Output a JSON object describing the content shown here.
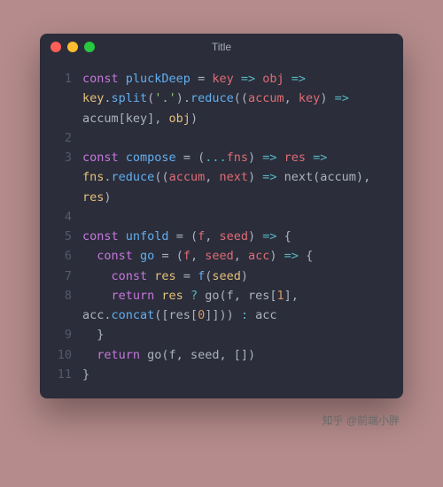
{
  "window": {
    "title": "Title",
    "dots": {
      "red": "#ff5f57",
      "yellow": "#febc2e",
      "green": "#28c840"
    }
  },
  "code": {
    "lines": [
      {
        "num": "1",
        "tokens": [
          {
            "t": "const ",
            "c": "kw"
          },
          {
            "t": "pluckDeep",
            "c": "fn"
          },
          {
            "t": " = ",
            "c": "pn"
          },
          {
            "t": "key",
            "c": "pr"
          },
          {
            "t": " => ",
            "c": "op"
          },
          {
            "t": "obj",
            "c": "pr"
          },
          {
            "t": " => ",
            "c": "op"
          },
          {
            "t": "key",
            "c": "id"
          },
          {
            "t": ".",
            "c": "pn"
          },
          {
            "t": "split",
            "c": "fn"
          },
          {
            "t": "(",
            "c": "pn"
          },
          {
            "t": "'.'",
            "c": "str"
          },
          {
            "t": ").",
            "c": "pn"
          },
          {
            "t": "reduce",
            "c": "fn"
          },
          {
            "t": "((",
            "c": "pn"
          },
          {
            "t": "accum",
            "c": "pr"
          },
          {
            "t": ", ",
            "c": "pn"
          },
          {
            "t": "key",
            "c": "pr"
          },
          {
            "t": ") ",
            "c": "pn"
          },
          {
            "t": "=>",
            "c": "op"
          },
          {
            "t": " accum[key], ",
            "c": "pn"
          },
          {
            "t": "obj",
            "c": "id"
          },
          {
            "t": ")",
            "c": "pn"
          }
        ]
      },
      {
        "num": "2",
        "tokens": []
      },
      {
        "num": "3",
        "tokens": [
          {
            "t": "const ",
            "c": "kw"
          },
          {
            "t": "compose",
            "c": "fn"
          },
          {
            "t": " = (",
            "c": "pn"
          },
          {
            "t": "...",
            "c": "op"
          },
          {
            "t": "fns",
            "c": "pr"
          },
          {
            "t": ") ",
            "c": "pn"
          },
          {
            "t": "=>",
            "c": "op"
          },
          {
            "t": " ",
            "c": "pn"
          },
          {
            "t": "res",
            "c": "pr"
          },
          {
            "t": " => ",
            "c": "op"
          },
          {
            "t": "fns",
            "c": "id"
          },
          {
            "t": ".",
            "c": "pn"
          },
          {
            "t": "reduce",
            "c": "fn"
          },
          {
            "t": "((",
            "c": "pn"
          },
          {
            "t": "accum",
            "c": "pr"
          },
          {
            "t": ", ",
            "c": "pn"
          },
          {
            "t": "next",
            "c": "pr"
          },
          {
            "t": ") ",
            "c": "pn"
          },
          {
            "t": "=>",
            "c": "op"
          },
          {
            "t": " next(accum), ",
            "c": "pn"
          },
          {
            "t": "res",
            "c": "id"
          },
          {
            "t": ")",
            "c": "pn"
          }
        ]
      },
      {
        "num": "4",
        "tokens": []
      },
      {
        "num": "5",
        "tokens": [
          {
            "t": "const ",
            "c": "kw"
          },
          {
            "t": "unfold",
            "c": "fn"
          },
          {
            "t": " = (",
            "c": "pn"
          },
          {
            "t": "f",
            "c": "pr"
          },
          {
            "t": ", ",
            "c": "pn"
          },
          {
            "t": "seed",
            "c": "pr"
          },
          {
            "t": ") ",
            "c": "pn"
          },
          {
            "t": "=>",
            "c": "op"
          },
          {
            "t": " {",
            "c": "pn"
          }
        ]
      },
      {
        "num": "6",
        "tokens": [
          {
            "t": "  ",
            "c": "pn"
          },
          {
            "t": "const ",
            "c": "kw"
          },
          {
            "t": "go",
            "c": "fn"
          },
          {
            "t": " = (",
            "c": "pn"
          },
          {
            "t": "f",
            "c": "pr"
          },
          {
            "t": ", ",
            "c": "pn"
          },
          {
            "t": "seed",
            "c": "pr"
          },
          {
            "t": ", ",
            "c": "pn"
          },
          {
            "t": "acc",
            "c": "pr"
          },
          {
            "t": ") ",
            "c": "pn"
          },
          {
            "t": "=>",
            "c": "op"
          },
          {
            "t": " {",
            "c": "pn"
          }
        ]
      },
      {
        "num": "7",
        "tokens": [
          {
            "t": "    ",
            "c": "pn"
          },
          {
            "t": "const ",
            "c": "kw"
          },
          {
            "t": "res",
            "c": "id"
          },
          {
            "t": " = ",
            "c": "pn"
          },
          {
            "t": "f",
            "c": "fn"
          },
          {
            "t": "(",
            "c": "pn"
          },
          {
            "t": "seed",
            "c": "id"
          },
          {
            "t": ")",
            "c": "pn"
          }
        ]
      },
      {
        "num": "8",
        "tokens": [
          {
            "t": "    ",
            "c": "pn"
          },
          {
            "t": "return ",
            "c": "kw"
          },
          {
            "t": "res ",
            "c": "id"
          },
          {
            "t": "?",
            "c": "op"
          },
          {
            "t": " go(f, res[",
            "c": "pn"
          },
          {
            "t": "1",
            "c": "num"
          },
          {
            "t": "], acc.",
            "c": "pn"
          },
          {
            "t": "concat",
            "c": "fn"
          },
          {
            "t": "([res[",
            "c": "pn"
          },
          {
            "t": "0",
            "c": "num"
          },
          {
            "t": "]])) ",
            "c": "pn"
          },
          {
            "t": ":",
            "c": "op"
          },
          {
            "t": " acc",
            "c": "pn"
          }
        ]
      },
      {
        "num": "9",
        "tokens": [
          {
            "t": "  }",
            "c": "pn"
          }
        ]
      },
      {
        "num": "10",
        "tokens": [
          {
            "t": "  ",
            "c": "pn"
          },
          {
            "t": "return ",
            "c": "kw"
          },
          {
            "t": "go(f, seed, [])",
            "c": "pn"
          }
        ]
      },
      {
        "num": "11",
        "tokens": [
          {
            "t": "}",
            "c": "pn"
          }
        ]
      }
    ]
  },
  "attribution": "知乎 @前端小胖"
}
